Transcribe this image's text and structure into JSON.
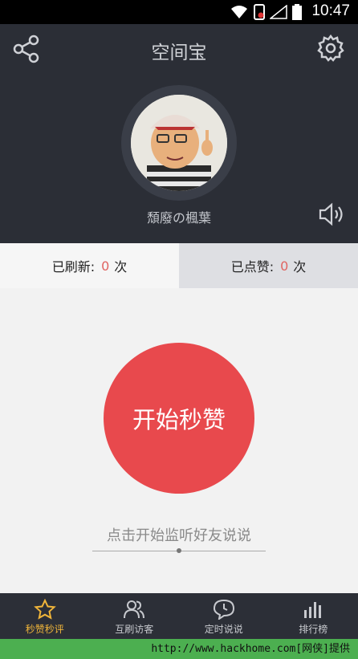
{
  "status_bar": {
    "time": "10:47"
  },
  "header": {
    "title": "空间宝",
    "username": "頹廢の楓葉",
    "icons": {
      "share": "share-icon",
      "settings": "gear-icon",
      "sound": "speaker-icon"
    }
  },
  "stats": {
    "refreshed_label": "已刷新:",
    "refreshed_count": "0",
    "refreshed_unit": "次",
    "liked_label": "已点赞:",
    "liked_count": "0",
    "liked_unit": "次"
  },
  "main": {
    "start_button": "开始秒赞",
    "hint": "点击开始监听好友说说"
  },
  "tabs": [
    {
      "label": "秒赞秒评",
      "icon": "star-icon",
      "active": true
    },
    {
      "label": "互刷访客",
      "icon": "users-icon",
      "active": false
    },
    {
      "label": "定时说说",
      "icon": "clock-bubble-icon",
      "active": false
    },
    {
      "label": "排行榜",
      "icon": "bar-chart-icon",
      "active": false
    }
  ],
  "footer": {
    "text": "http://www.hackhome.com[网侠]提供"
  },
  "colors": {
    "accent": "#e8494d",
    "active_tab": "#f0b53a",
    "header_bg": "#2b2e36",
    "footer_bg": "#4caf50"
  }
}
